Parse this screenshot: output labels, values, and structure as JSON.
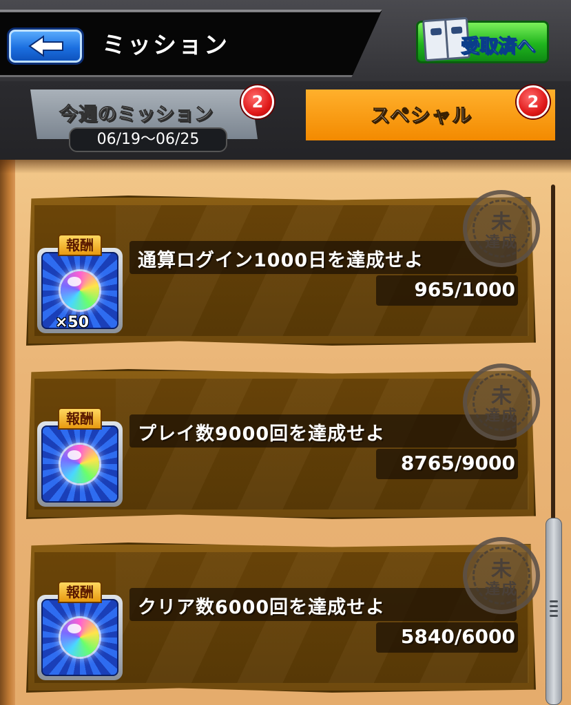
{
  "header": {
    "title": "ミッション",
    "received_button_label": "受取済へ"
  },
  "tabs": {
    "weekly": {
      "label": "今週のミッション",
      "dates": "06/19〜06/25",
      "badge": "2"
    },
    "special": {
      "label": "スペシャル",
      "badge": "2",
      "active": true
    }
  },
  "missions": [
    {
      "reward_label": "報酬",
      "reward_qty": "×50",
      "text": "通算ログイン1000日を達成せよ",
      "progress": "965/1000",
      "stamp_top": "未",
      "stamp_bottom": "達成"
    },
    {
      "reward_label": "報酬",
      "reward_qty": "",
      "text": "プレイ数9000回を達成せよ",
      "progress": "8765/9000",
      "stamp_top": "未",
      "stamp_bottom": "達成"
    },
    {
      "reward_label": "報酬",
      "reward_qty": "",
      "text": "クリア数6000回を達成せよ",
      "progress": "5840/6000",
      "stamp_top": "未",
      "stamp_bottom": "達成"
    }
  ],
  "colors": {
    "accent_orange": "#f38a00",
    "badge_red": "#e01a1a",
    "back_button_blue": "#1b6fe0",
    "received_button_green": "#20b51e"
  },
  "icons": [
    "back-arrow-icon",
    "book-icon",
    "rainbow-orb-icon",
    "unachieved-stamp-icon"
  ]
}
